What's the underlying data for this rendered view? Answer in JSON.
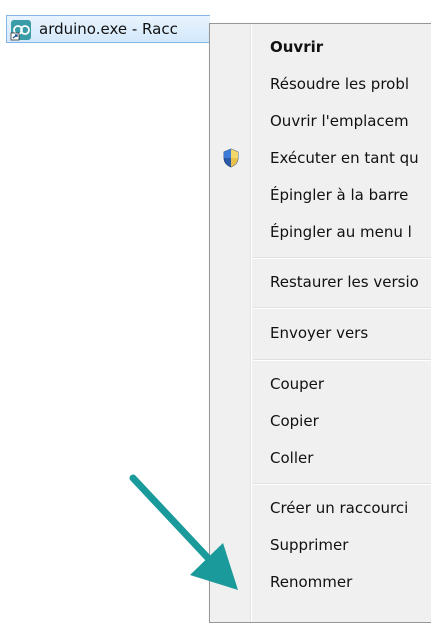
{
  "file": {
    "name": "arduino.exe - Racc",
    "icon": "arduino-shortcut-icon"
  },
  "menu": {
    "items": [
      {
        "label": "Ouvrir",
        "bold": true
      },
      {
        "label": "Résoudre les probl"
      },
      {
        "label": "Ouvrir l'emplacem"
      },
      {
        "label": "Exécuter en tant qu",
        "icon": "uac-shield-icon"
      },
      {
        "label": "Épingler à la barre"
      },
      {
        "label": "Épingler au menu l"
      },
      {
        "label": "Restaurer les versio"
      },
      {
        "label": "Envoyer vers"
      },
      {
        "label": "Couper"
      },
      {
        "label": "Copier"
      },
      {
        "label": "Coller"
      },
      {
        "label": "Créer un raccourci"
      },
      {
        "label": "Supprimer"
      },
      {
        "label": "Renommer"
      }
    ]
  },
  "annotation": {
    "icon": "teal-arrow-icon",
    "color": "#1a9a9a"
  }
}
